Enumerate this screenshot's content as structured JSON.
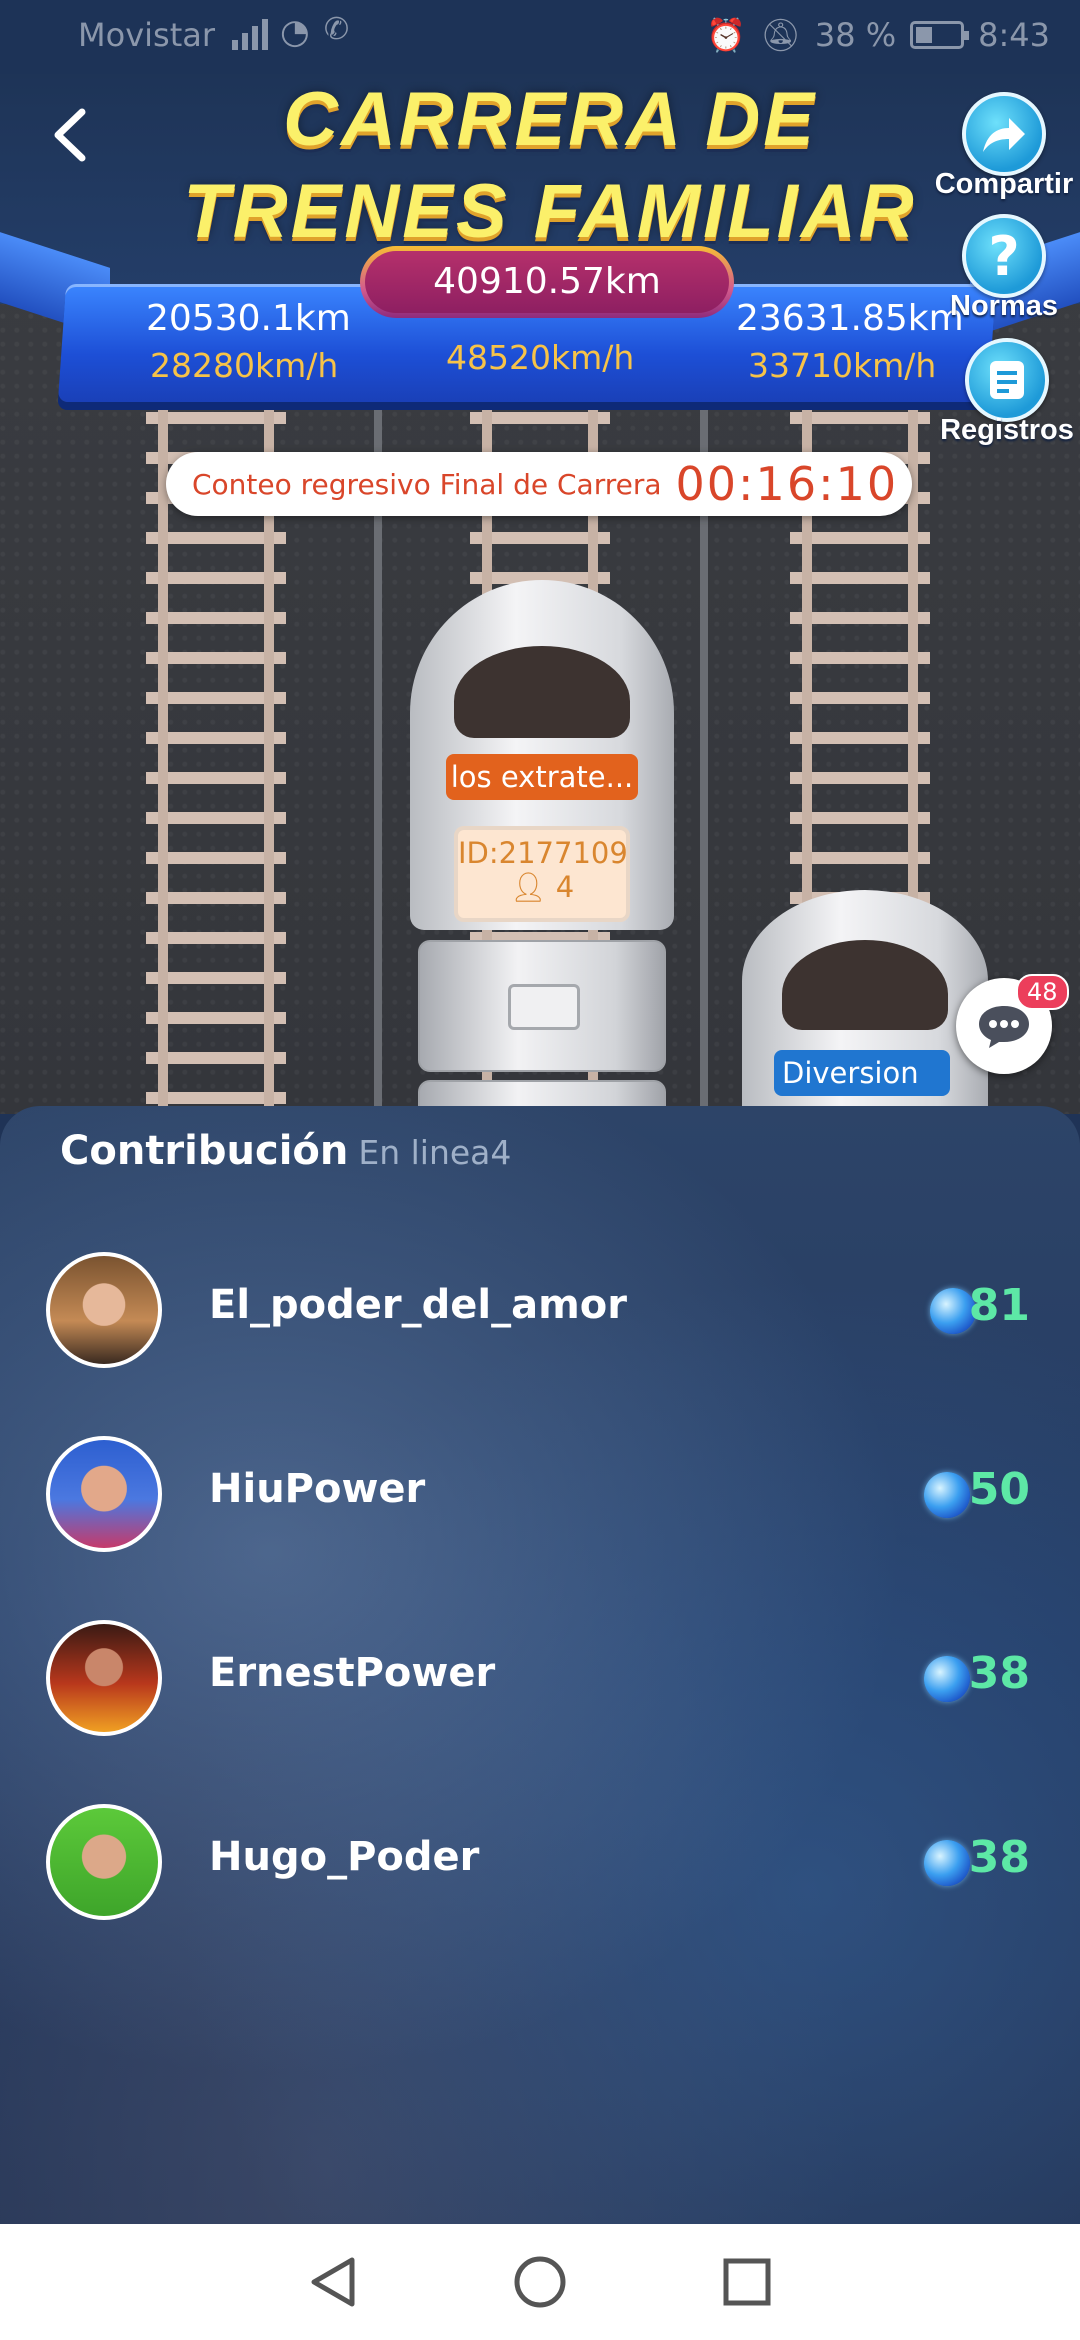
{
  "status_bar": {
    "carrier": "Movistar",
    "battery": "38 %",
    "time": "8:43"
  },
  "header": {
    "title_line1": "CARRERA DE",
    "title_line2": "TRENES FAMILIAR"
  },
  "race": {
    "total_distance": "40910.57km",
    "left": {
      "distance": "20530.1km",
      "speed": "28280km/h"
    },
    "center": {
      "speed": "48520km/h"
    },
    "right": {
      "distance": "23631.85km",
      "speed": "33710km/h"
    },
    "countdown_label": "Conteo regresivo Final de Carrera",
    "countdown_time": "00:16:10"
  },
  "trains": {
    "center": {
      "name": "los extrate...",
      "id": "ID:2177109",
      "members": "4"
    },
    "right": {
      "name": "Diversion ..."
    }
  },
  "side_buttons": {
    "share": "Compartir",
    "rules": "Normas",
    "records": "Registros"
  },
  "chat": {
    "badge": "48"
  },
  "contribution": {
    "title": "Contribución",
    "online": "En linea4",
    "rows": [
      {
        "name": "El_poder_del_amor",
        "score": "81"
      },
      {
        "name": "HiuPower",
        "score": "50"
      },
      {
        "name": "ErnestPower",
        "score": "38"
      },
      {
        "name": "Hugo_Poder",
        "score": "38"
      }
    ]
  },
  "colors": {
    "accent_gold": "#fbf06a",
    "score_green": "#5de8a6",
    "countdown_red": "#d9462a",
    "banner_blue": "#2a62e8"
  }
}
